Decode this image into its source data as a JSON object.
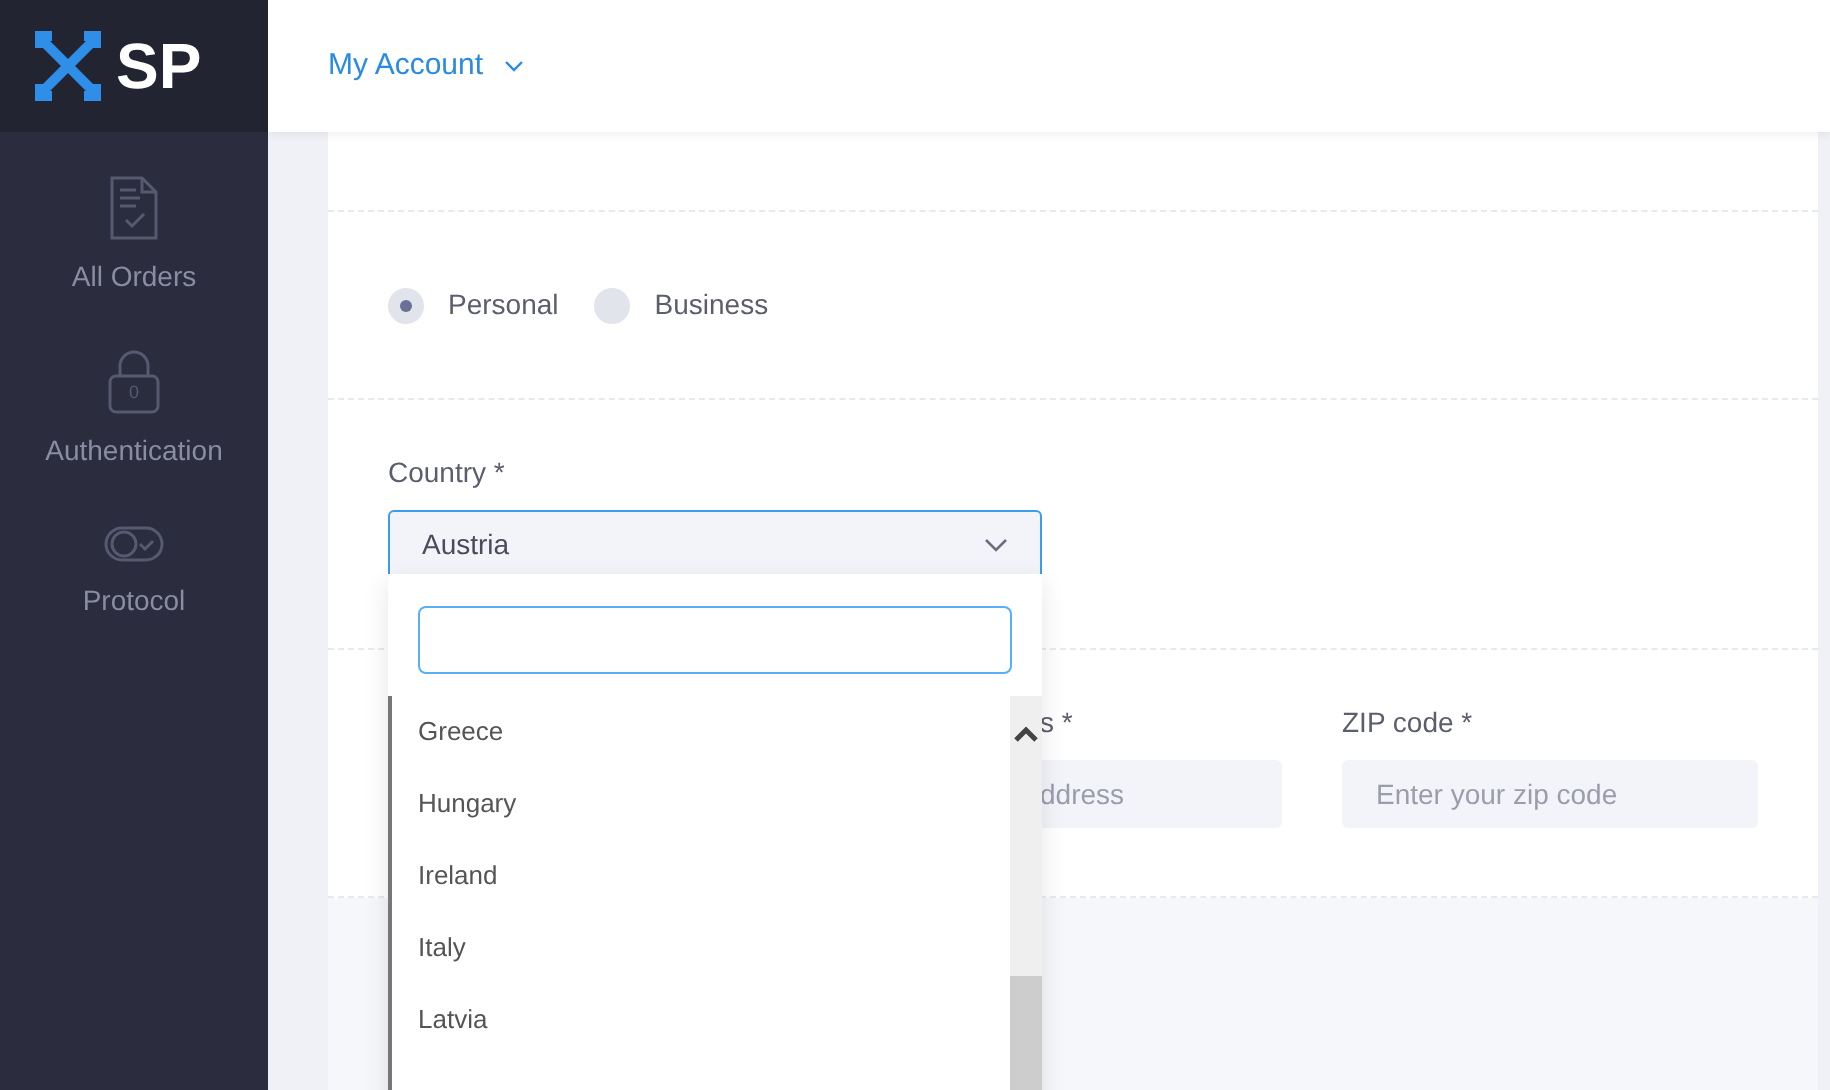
{
  "logo": {
    "text": "SP"
  },
  "header": {
    "menu": "My Account"
  },
  "sidebar": {
    "items": [
      {
        "label": "All Orders",
        "kind": "orders"
      },
      {
        "label": "Authentication",
        "kind": "lock",
        "badge": "0"
      },
      {
        "label": "Protocol",
        "kind": "toggle"
      }
    ]
  },
  "account_type": [
    {
      "label": "Personal",
      "selected": true
    },
    {
      "label": "Business",
      "selected": false
    }
  ],
  "country": {
    "label": "Country *",
    "value": "Austria"
  },
  "country_dropdown": {
    "expanded": true,
    "items": [
      {
        "label": "Greece"
      },
      {
        "label": "Hungary"
      },
      {
        "label": "Ireland"
      },
      {
        "label": "Italy"
      },
      {
        "label": "Latvia"
      }
    ]
  },
  "address": {
    "label": "s *",
    "placeholder": "ddress"
  },
  "zip": {
    "label": "ZIP code *",
    "placeholder": "Enter your zip code"
  }
}
